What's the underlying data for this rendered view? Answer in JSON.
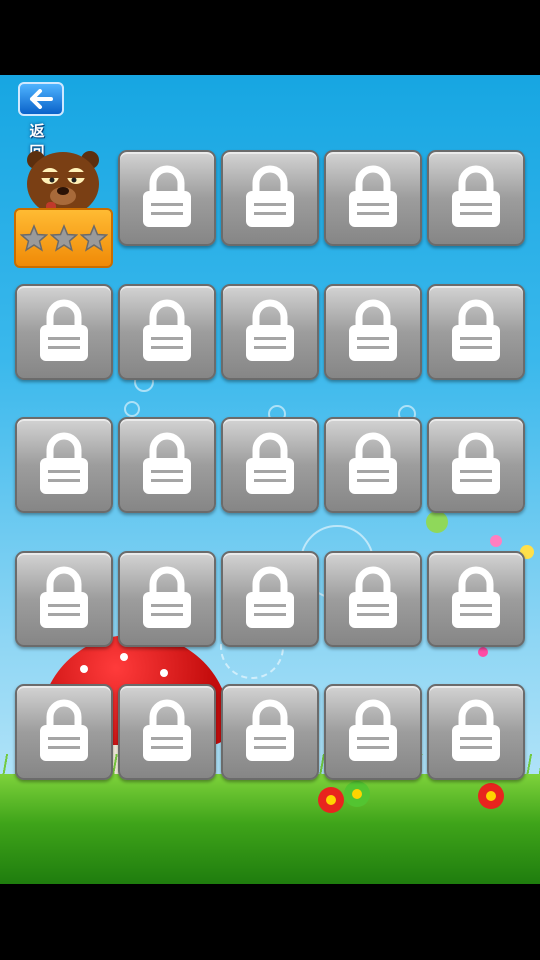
{
  "header": {
    "back_label": "返 回"
  },
  "levels": {
    "rows": 5,
    "columns": 5,
    "unlocked_count": 1,
    "locked_count": 24,
    "level_1": {
      "stars_total": 3,
      "stars_earned": 0
    }
  },
  "icons": {
    "back": "left-arrow-icon",
    "locked": "padlock-icon",
    "star": "star-icon",
    "level_1_character": "bear-icon"
  },
  "colors": {
    "sky_top": "#17a6e2",
    "sky_bottom": "#c9ecfb",
    "tile_locked": "#9d9d9d",
    "level_plate": "#f5a21c",
    "back_button": "#1d7de0",
    "grass": "#3fa41a"
  }
}
